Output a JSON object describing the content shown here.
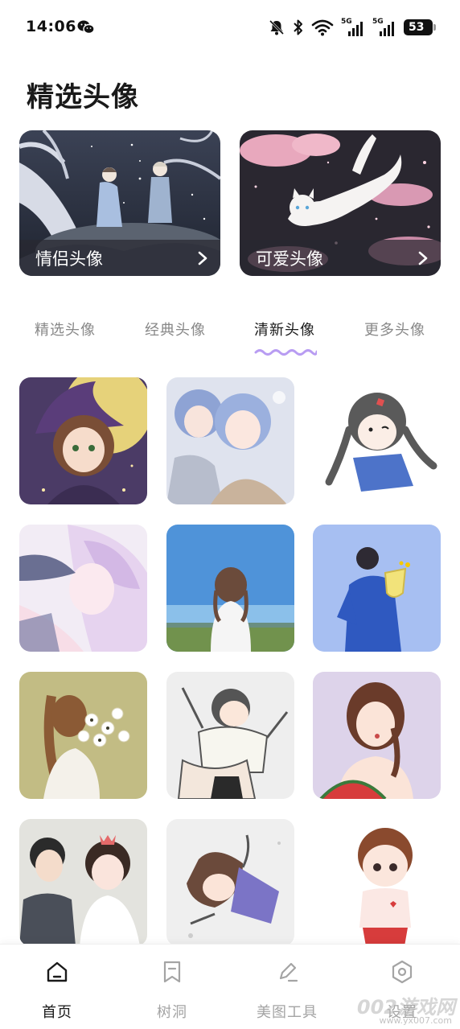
{
  "status_bar": {
    "time": "14:06",
    "network_tag_1": "5G",
    "network_tag_2": "5G",
    "battery": "53"
  },
  "header": {
    "title": "精选头像"
  },
  "featured": [
    {
      "label": "情侣头像",
      "icon": "chevron-right-icon"
    },
    {
      "label": "可爱头像",
      "icon": "chevron-right-icon"
    }
  ],
  "tabs": [
    {
      "label": "精选头像",
      "active": false
    },
    {
      "label": "经典头像",
      "active": false
    },
    {
      "label": "清新头像",
      "active": true
    },
    {
      "label": "更多头像",
      "active": false
    }
  ],
  "accent_color": "#b89cf2",
  "bottom_nav": [
    {
      "label": "首页",
      "icon": "home-icon",
      "active": true
    },
    {
      "label": "树洞",
      "icon": "bookmark-icon",
      "active": false
    },
    {
      "label": "美图工具",
      "icon": "pen-icon",
      "active": false
    },
    {
      "label": "设置",
      "icon": "settings-icon",
      "active": false
    }
  ],
  "watermark": {
    "text": "002游戏网",
    "sub": "www.yx007.com"
  }
}
